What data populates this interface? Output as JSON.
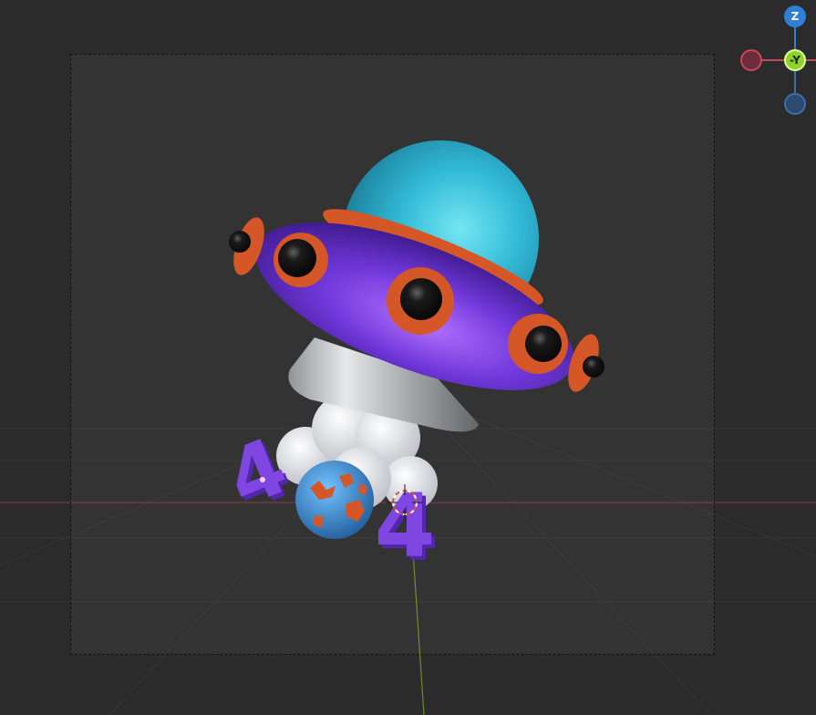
{
  "viewport": {
    "background": "#2b2b2b",
    "grid_color": "#3a3a3a",
    "x_axis_color": "#8a3a44",
    "y_axis_color": "#6b8a2a"
  },
  "navigation_gizmo": {
    "z_label": "Z",
    "y_label": "-Y",
    "colors": {
      "x": "#c8475a",
      "y": "#8ed22a",
      "z": "#2f7fd6"
    }
  },
  "scene": {
    "ufo_body_color": "#6a2fd8",
    "ufo_ring_color": "#d4501f",
    "dome_color": "#2ab8d6",
    "base_color": "#bfc3c6",
    "cloud_color": "#e8e8ec",
    "number_color": "#7a3fe0",
    "planet_color": "#3a8fd6",
    "planet_spot_color": "#d4501f",
    "numbers": [
      "4",
      "4"
    ]
  }
}
